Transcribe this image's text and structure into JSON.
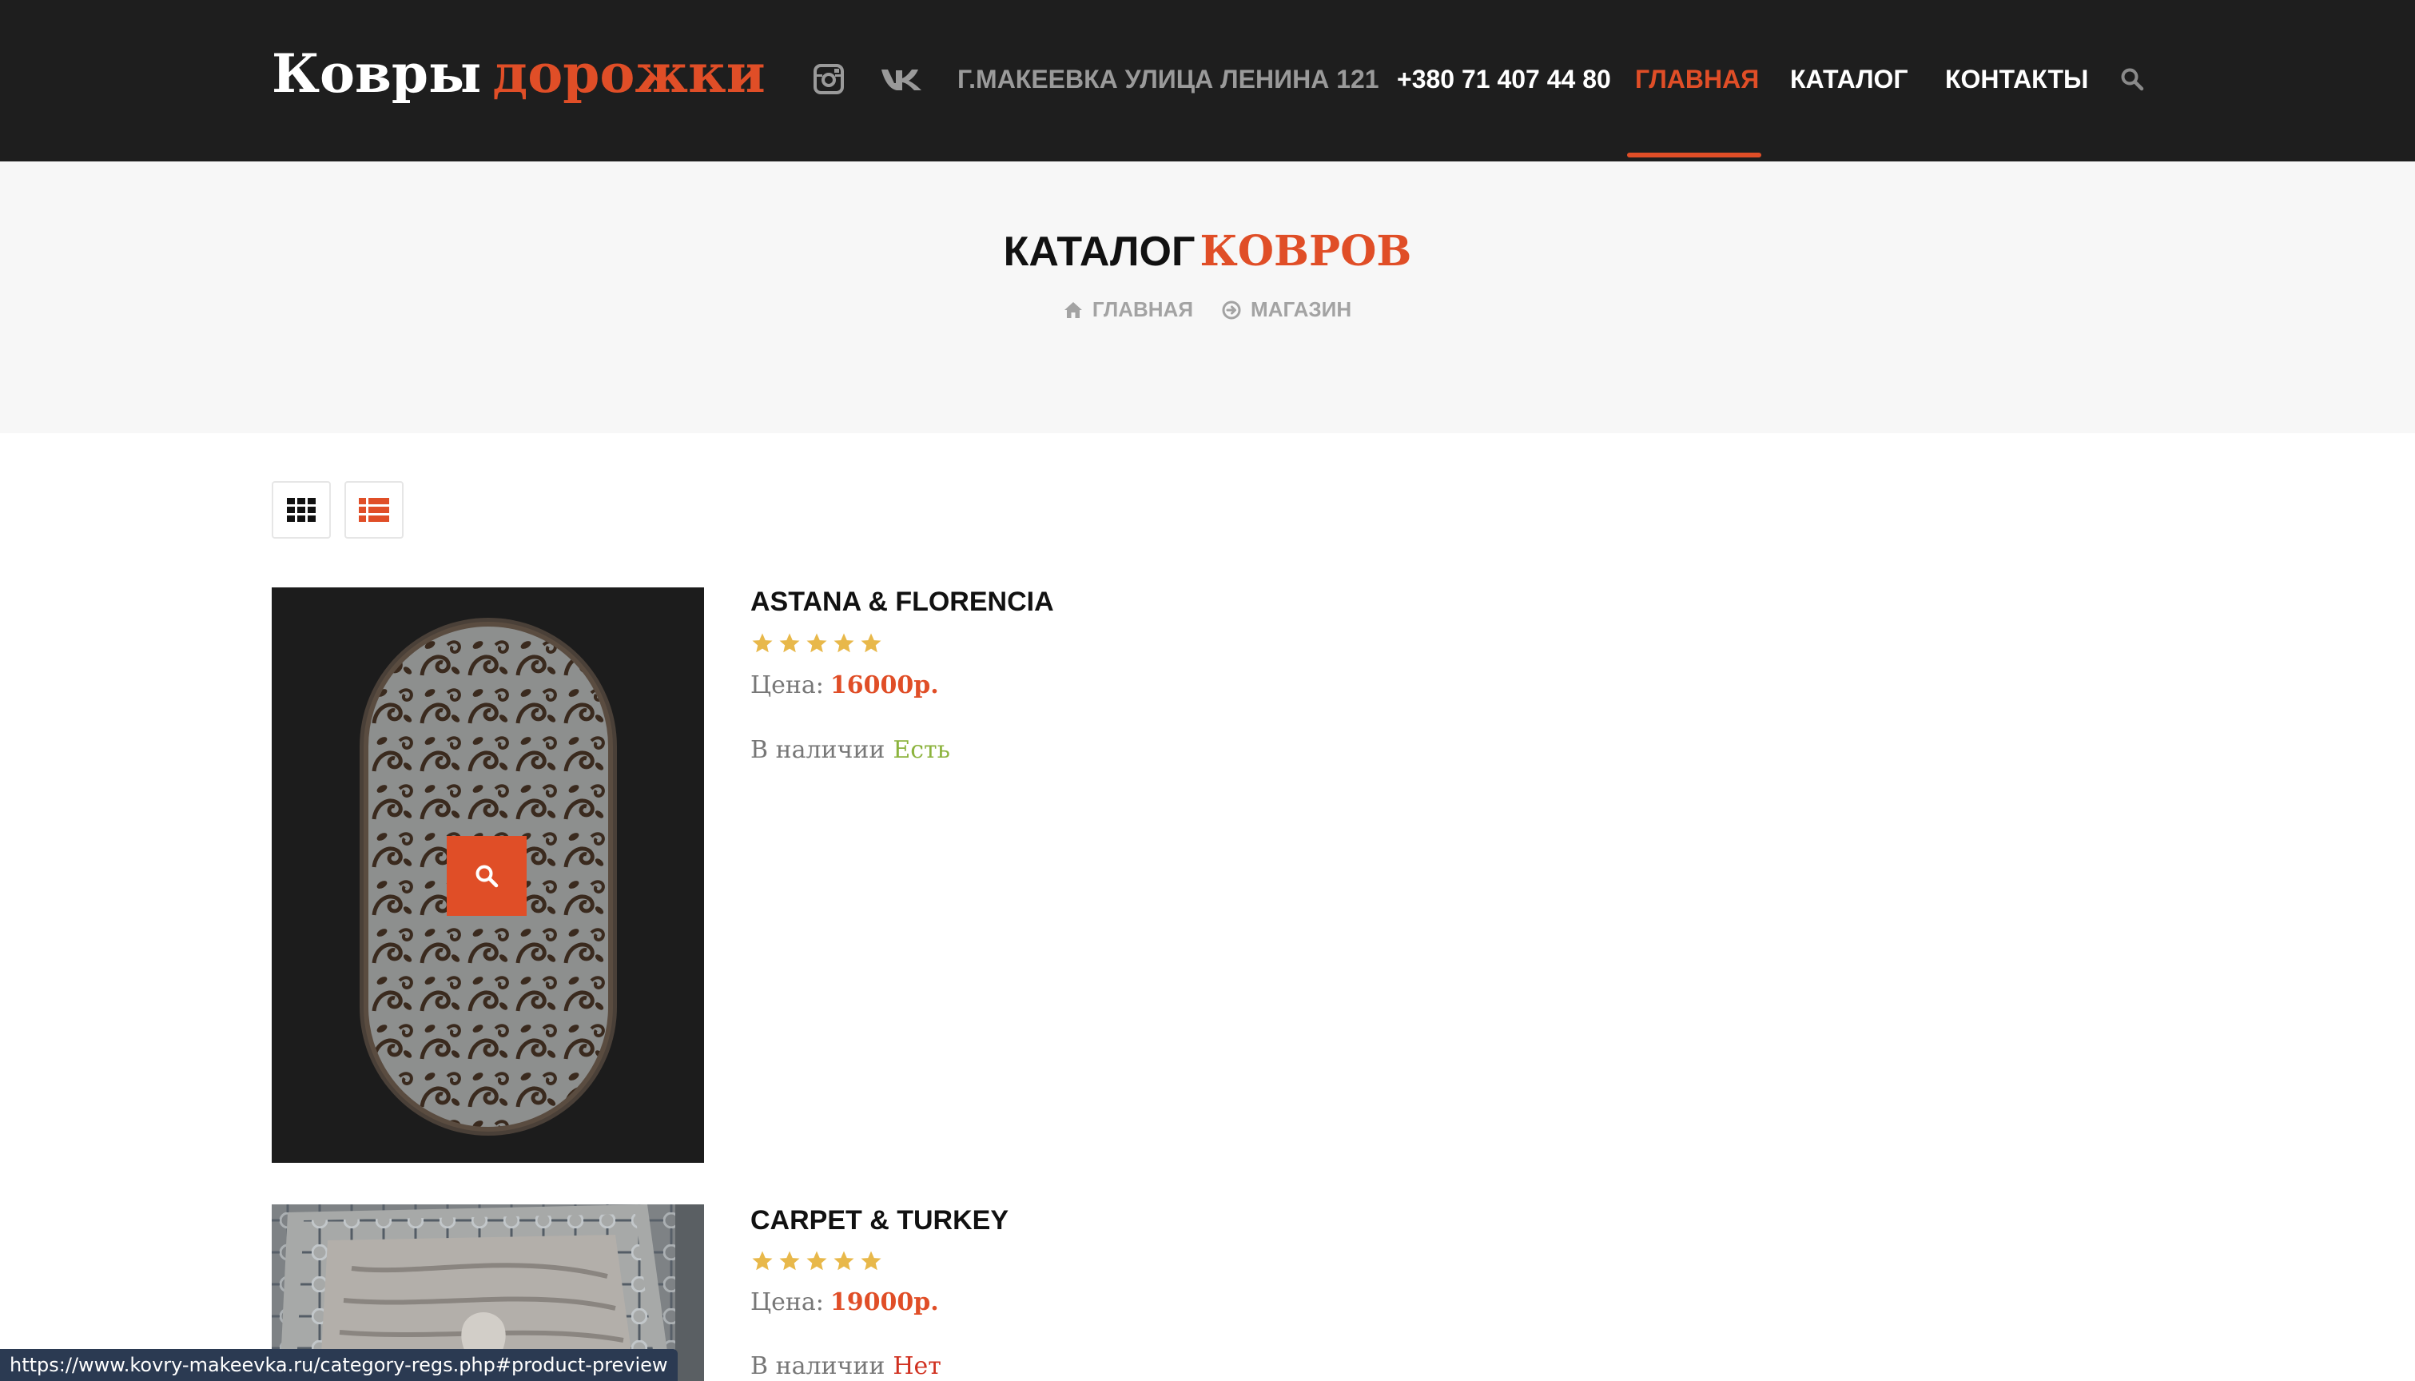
{
  "header": {
    "logo": {
      "word1": "Ковры",
      "word2": "дорожки"
    },
    "social": [
      "instagram-icon",
      "vk-icon"
    ],
    "address": "Г.МАКЕЕВКА УЛИЦА ЛЕНИНА 121",
    "phone": "+380 71 407 44 80",
    "nav": [
      {
        "label": "ГЛАВНАЯ",
        "active": true
      },
      {
        "label": "КАТАЛОГ",
        "active": false
      },
      {
        "label": "КОНТАКТЫ",
        "active": false
      }
    ],
    "search_icon": "search-icon"
  },
  "page": {
    "title_part1": "КАТАЛОГ",
    "title_part2": "КОВРОВ",
    "breadcrumb": [
      {
        "label": "ГЛАВНАЯ",
        "icon": "home-icon"
      },
      {
        "label": "МАГАЗИН",
        "icon": "arrow-circle-right-icon"
      }
    ]
  },
  "view_toggles": [
    {
      "name": "grid-view",
      "icon": "grid-icon"
    },
    {
      "name": "list-view",
      "icon": "list-icon"
    }
  ],
  "products": [
    {
      "name": "ASTANA & FLORENCIA",
      "rating": 5,
      "price_label": "Цена:",
      "price": "16000р.",
      "stock_label": "В наличии",
      "stock": "Есть"
    },
    {
      "name": "CARPET & TURKEY",
      "rating": 5,
      "price_label": "Цена:",
      "price": "19000р.",
      "stock_label": "В наличии",
      "stock": "Нет"
    }
  ],
  "status_bar": {
    "url": "https://www.kovry-makeevka.ru/category-regs.php#product-preview"
  },
  "colors": {
    "accent": "#e04e27",
    "header_bg": "#1e1e1e",
    "band_bg": "#f7f7f7",
    "in_stock": "#8cb33d",
    "out_of_stock": "#d0301f",
    "star": "#e8b84a"
  }
}
